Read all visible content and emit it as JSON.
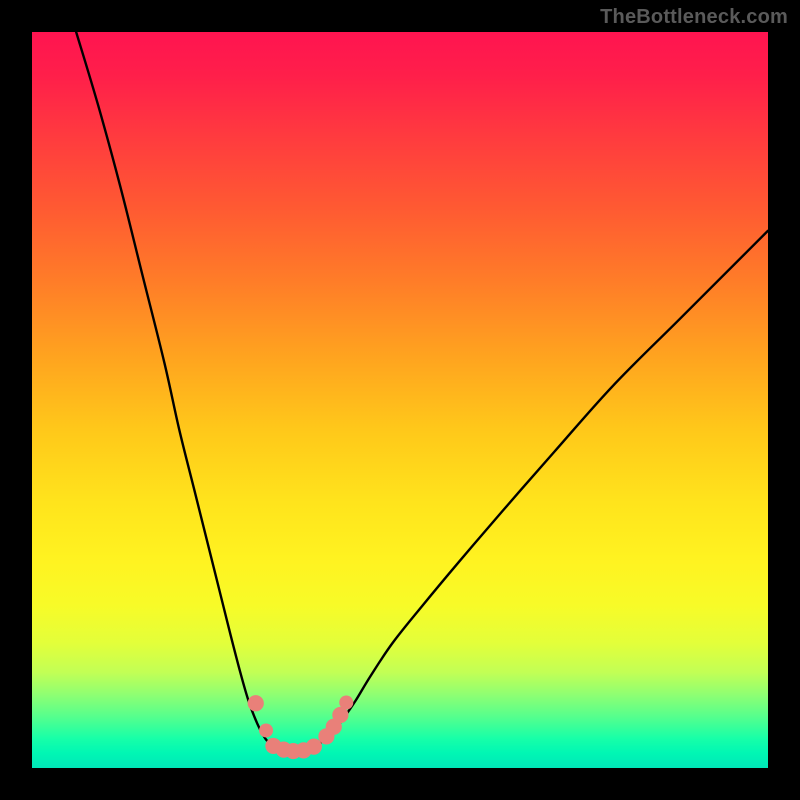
{
  "watermark": "TheBottleneck.com",
  "chart_data": {
    "type": "line",
    "title": "",
    "xlabel": "",
    "ylabel": "",
    "xlim": [
      0,
      100
    ],
    "ylim": [
      0,
      100
    ],
    "grid": false,
    "legend": false,
    "background_gradient": [
      "#ff1450",
      "#ffe41c",
      "#00e6b8"
    ],
    "series": [
      {
        "name": "left-curve",
        "x": [
          6,
          9,
          12,
          15,
          18,
          20,
          22,
          24,
          25.5,
          27,
          28.3,
          29.3,
          30.2,
          31.0,
          31.7,
          32.4
        ],
        "values": [
          100,
          90,
          79,
          67,
          55,
          46,
          38,
          30,
          24,
          18,
          13,
          9.5,
          7,
          5.2,
          4.0,
          3.2
        ]
      },
      {
        "name": "valley-floor",
        "x": [
          32.4,
          33.2,
          34.0,
          34.8,
          35.6,
          36.4,
          37.2,
          38.0,
          39.0,
          40.0
        ],
        "values": [
          3.2,
          2.6,
          2.3,
          2.2,
          2.2,
          2.3,
          2.5,
          2.8,
          3.3,
          4.1
        ]
      },
      {
        "name": "right-curve",
        "x": [
          40.0,
          41.2,
          42.5,
          44,
          46,
          49,
          53,
          58,
          64,
          71,
          79,
          88,
          97,
          100
        ],
        "values": [
          4.1,
          5.3,
          7.0,
          9.2,
          12.5,
          17,
          22,
          28,
          35,
          43,
          52,
          61,
          70,
          73
        ]
      }
    ],
    "markers": [
      {
        "x": 30.4,
        "y": 8.8,
        "r": 1.1
      },
      {
        "x": 31.8,
        "y": 5.1,
        "r": 0.95
      },
      {
        "x": 32.8,
        "y": 3.0,
        "r": 1.1
      },
      {
        "x": 34.2,
        "y": 2.5,
        "r": 1.1
      },
      {
        "x": 35.5,
        "y": 2.3,
        "r": 1.1
      },
      {
        "x": 36.9,
        "y": 2.4,
        "r": 1.1
      },
      {
        "x": 38.3,
        "y": 2.9,
        "r": 1.1
      },
      {
        "x": 40.0,
        "y": 4.3,
        "r": 1.1
      },
      {
        "x": 41.0,
        "y": 5.6,
        "r": 1.1
      },
      {
        "x": 41.9,
        "y": 7.2,
        "r": 1.1
      },
      {
        "x": 42.7,
        "y": 8.9,
        "r": 0.95
      }
    ]
  }
}
